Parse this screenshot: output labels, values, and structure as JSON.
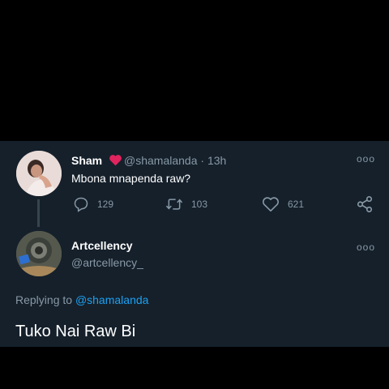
{
  "original_tweet": {
    "author_name": "Sham",
    "handle": "@shamalanda",
    "time": "· 13h",
    "text": "Mbona mnapenda raw?",
    "reply_count": "129",
    "retweet_count": "103",
    "like_count": "621",
    "name_emoji": "red-heart-icon"
  },
  "reply_tweet": {
    "author_name": "Artcellency",
    "handle": "@artcellency_",
    "replying_prefix": "Replying to",
    "replying_to": "@shamalanda",
    "text": "Tuko Nai Raw Bi"
  },
  "more_label": "ooo",
  "colors": {
    "background": "#15202b",
    "secondary_text": "#8899a6",
    "accent": "#1da1f2",
    "heart": "#e0245e"
  }
}
